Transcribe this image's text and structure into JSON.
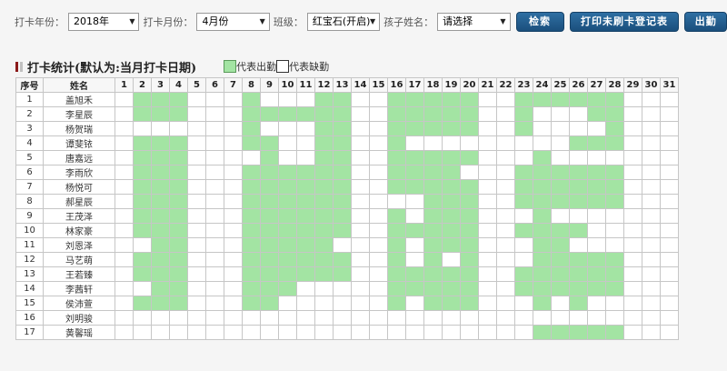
{
  "filters": {
    "year_label": "打卡年份：",
    "year_value": "2018年",
    "month_label": "打卡月份：",
    "month_value": "4月份",
    "class_label": "班级：",
    "class_value": "红宝石(开启)",
    "child_label": "孩子姓名：",
    "child_value": "请选择",
    "caret": "▼"
  },
  "buttons": {
    "search": "检索",
    "print": "打印未刷卡登记表",
    "attendance": "出勤"
  },
  "section": {
    "title": "打卡统计(默认为:当月打卡日期)",
    "legend_present": "代表出勤",
    "legend_absent": "代表缺勤"
  },
  "colors": {
    "present": "#a3e4a3",
    "absent": "#ffffff",
    "button": "#1f5a8c",
    "title_mark": "#8b1a1a"
  },
  "table": {
    "header_index": "序号",
    "header_name": "姓名",
    "days": [
      "1",
      "2",
      "3",
      "4",
      "5",
      "6",
      "7",
      "8",
      "9",
      "10",
      "11",
      "12",
      "13",
      "14",
      "15",
      "16",
      "17",
      "18",
      "19",
      "20",
      "21",
      "22",
      "23",
      "24",
      "25",
      "26",
      "27",
      "28",
      "29",
      "30",
      "31"
    ],
    "rows": [
      {
        "index": "1",
        "name": "盖旭禾",
        "present": [
          2,
          3,
          4,
          8,
          12,
          13,
          16,
          17,
          18,
          19,
          20,
          23,
          24,
          25,
          26,
          27,
          28
        ]
      },
      {
        "index": "2",
        "name": "李星辰",
        "present": [
          2,
          3,
          4,
          8,
          9,
          10,
          11,
          12,
          13,
          16,
          17,
          18,
          19,
          20,
          23,
          27,
          28
        ]
      },
      {
        "index": "3",
        "name": "杨贺瑞",
        "present": [
          8,
          12,
          13,
          16,
          17,
          18,
          19,
          20,
          23,
          28
        ]
      },
      {
        "index": "4",
        "name": "谭斐铱",
        "present": [
          2,
          3,
          4,
          8,
          9,
          12,
          13,
          16,
          26,
          27,
          28
        ]
      },
      {
        "index": "5",
        "name": "唐嘉远",
        "present": [
          2,
          3,
          4,
          9,
          12,
          13,
          16,
          17,
          18,
          19,
          20,
          24
        ]
      },
      {
        "index": "6",
        "name": "李雨欣",
        "present": [
          2,
          3,
          4,
          8,
          9,
          10,
          11,
          12,
          13,
          16,
          17,
          18,
          19,
          23,
          24,
          25,
          26,
          27,
          28
        ]
      },
      {
        "index": "7",
        "name": "杨悦可",
        "present": [
          2,
          3,
          4,
          8,
          9,
          10,
          11,
          12,
          13,
          16,
          17,
          18,
          19,
          20,
          23,
          24,
          25,
          26,
          27,
          28
        ]
      },
      {
        "index": "8",
        "name": "郝星辰",
        "present": [
          2,
          3,
          4,
          8,
          9,
          10,
          11,
          12,
          13,
          18,
          19,
          20,
          23,
          24,
          25,
          26,
          27,
          28
        ]
      },
      {
        "index": "9",
        "name": "王茂泽",
        "present": [
          2,
          3,
          4,
          8,
          9,
          10,
          11,
          12,
          13,
          16,
          18,
          19,
          20,
          24
        ]
      },
      {
        "index": "10",
        "name": "林家豪",
        "present": [
          2,
          3,
          4,
          8,
          9,
          10,
          11,
          12,
          13,
          16,
          17,
          18,
          19,
          20,
          23,
          24,
          25,
          26
        ]
      },
      {
        "index": "11",
        "name": "刘恩泽",
        "present": [
          3,
          4,
          8,
          9,
          10,
          11,
          12,
          16,
          18,
          19,
          20,
          24,
          25
        ]
      },
      {
        "index": "12",
        "name": "马艺萌",
        "present": [
          2,
          3,
          4,
          8,
          9,
          10,
          11,
          12,
          13,
          16,
          18,
          20,
          24,
          25,
          26,
          27,
          28
        ]
      },
      {
        "index": "13",
        "name": "王若臻",
        "present": [
          2,
          3,
          4,
          8,
          9,
          10,
          11,
          12,
          13,
          16,
          17,
          18,
          19,
          20,
          23,
          24,
          25,
          26,
          27,
          28
        ]
      },
      {
        "index": "14",
        "name": "李茜轩",
        "present": [
          3,
          4,
          8,
          9,
          10,
          16,
          17,
          18,
          19,
          20,
          23,
          24,
          25,
          26,
          27,
          28
        ]
      },
      {
        "index": "15",
        "name": "侯沛萱",
        "present": [
          2,
          3,
          4,
          8,
          9,
          16,
          18,
          19,
          20,
          24,
          26
        ]
      },
      {
        "index": "16",
        "name": "刘明骏",
        "present": []
      },
      {
        "index": "17",
        "name": "黄馨瑶",
        "present": [
          24,
          25,
          26,
          27,
          28
        ]
      }
    ]
  }
}
